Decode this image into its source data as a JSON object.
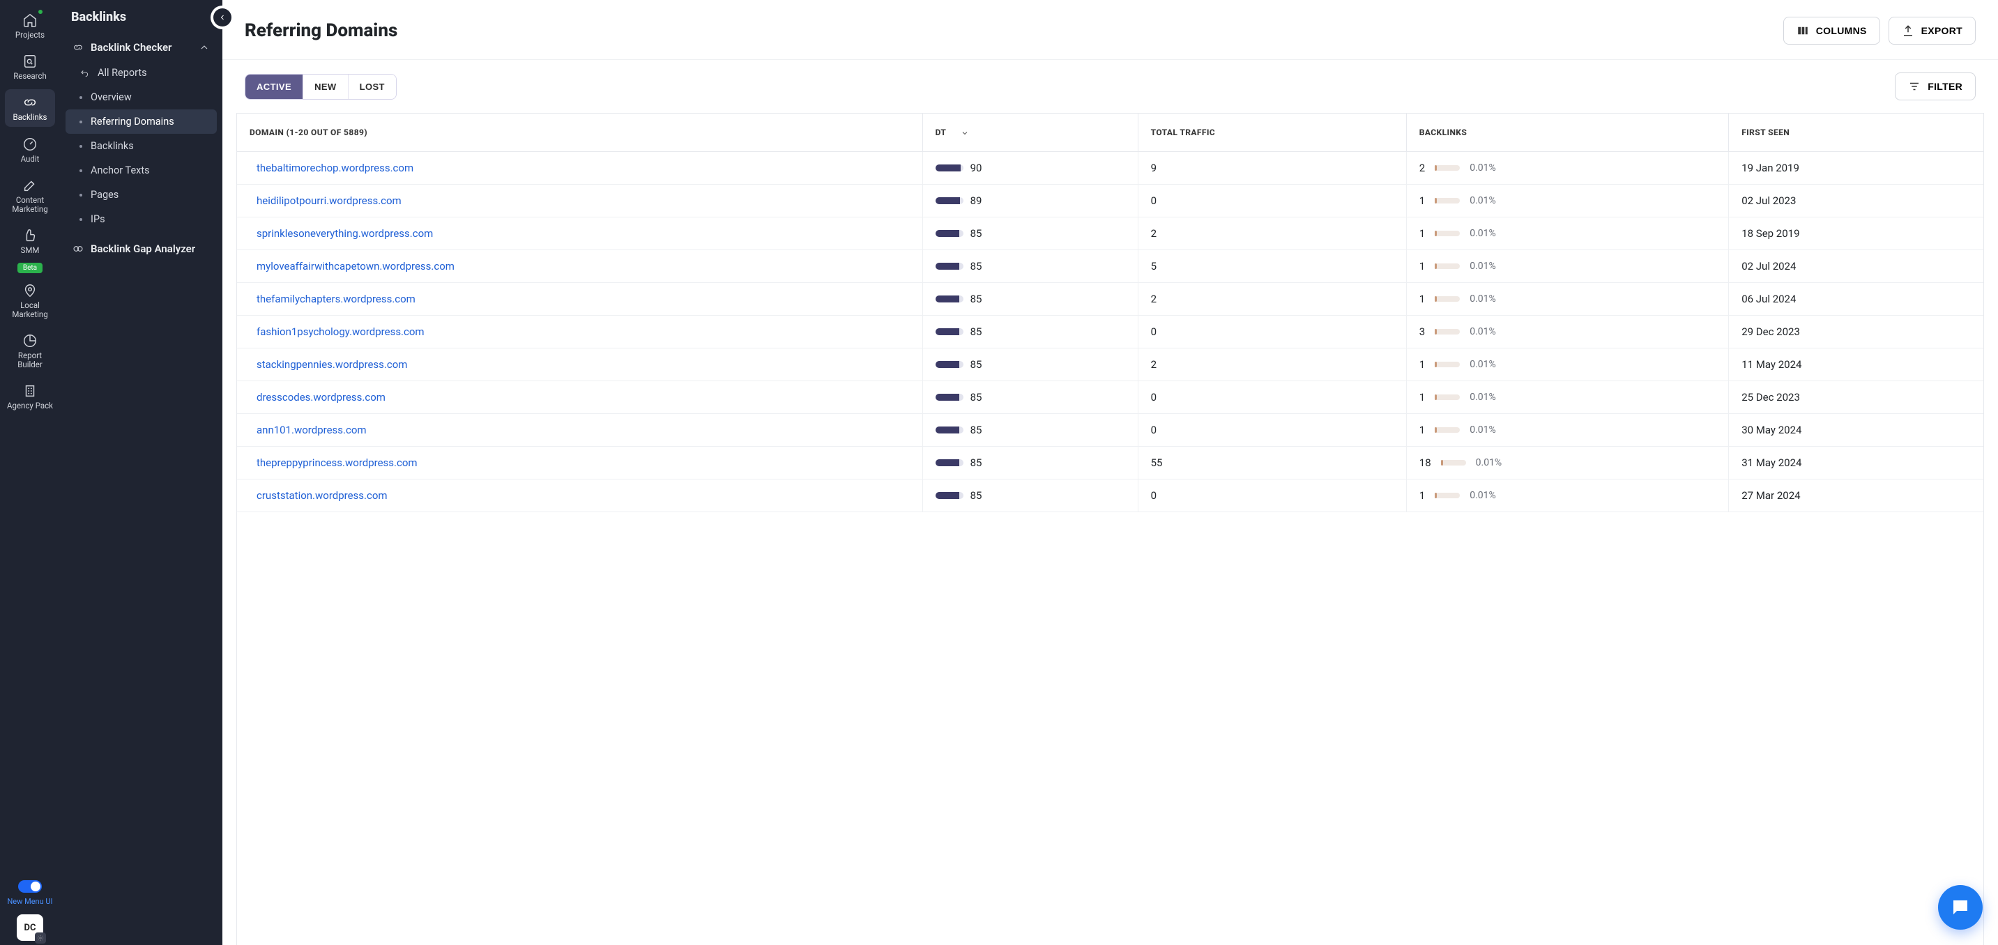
{
  "rail": {
    "items": [
      {
        "label": "Projects",
        "icon": "home"
      },
      {
        "label": "Research",
        "icon": "file-search"
      },
      {
        "label": "Backlinks",
        "icon": "link",
        "active": true
      },
      {
        "label": "Audit",
        "icon": "gauge"
      },
      {
        "label": "Content Marketing",
        "icon": "edit"
      },
      {
        "label": "SMM",
        "icon": "thumb",
        "badge": "Beta"
      },
      {
        "label": "Local Marketing",
        "icon": "pin"
      },
      {
        "label": "Report Builder",
        "icon": "pie"
      },
      {
        "label": "Agency Pack",
        "icon": "building"
      }
    ],
    "toggle_label": "New Menu UI",
    "avatar": "DC"
  },
  "sidebar": {
    "title": "Backlinks",
    "group_label": "Backlink Checker",
    "items": [
      {
        "label": "All Reports",
        "icon": "back"
      },
      {
        "label": "Overview"
      },
      {
        "label": "Referring Domains",
        "active": true
      },
      {
        "label": "Backlinks"
      },
      {
        "label": "Anchor Texts"
      },
      {
        "label": "Pages"
      },
      {
        "label": "IPs"
      }
    ],
    "group2_label": "Backlink Gap Analyzer"
  },
  "header": {
    "title": "Referring Domains",
    "columns_btn": "COLUMNS",
    "export_btn": "EXPORT"
  },
  "tabs": {
    "active": "ACTIVE",
    "new": "NEW",
    "lost": "LOST"
  },
  "filter_btn": "FILTER",
  "table": {
    "columns": {
      "domain": "DOMAIN (1-20 OUT OF 5889)",
      "dt": "DT",
      "traffic": "TOTAL TRAFFIC",
      "backlinks": "BACKLINKS",
      "first": "FIRST SEEN"
    },
    "rows": [
      {
        "domain": "thebaltimorechop.wordpress.com",
        "dt": 90,
        "traffic": "9",
        "bl": 2,
        "pct": "0.01%",
        "first": "19 Jan 2019"
      },
      {
        "domain": "heidilipotpourri.wordpress.com",
        "dt": 89,
        "traffic": "0",
        "bl": 1,
        "pct": "0.01%",
        "first": "02 Jul 2023"
      },
      {
        "domain": "sprinklesoneverything.wordpress.com",
        "dt": 85,
        "traffic": "2",
        "bl": 1,
        "pct": "0.01%",
        "first": "18 Sep 2019"
      },
      {
        "domain": "myloveaffairwithcapetown.wordpress.com",
        "dt": 85,
        "traffic": "5",
        "bl": 1,
        "pct": "0.01%",
        "first": "02 Jul 2024"
      },
      {
        "domain": "thefamilychapters.wordpress.com",
        "dt": 85,
        "traffic": "2",
        "bl": 1,
        "pct": "0.01%",
        "first": "06 Jul 2024"
      },
      {
        "domain": "fashion1psychology.wordpress.com",
        "dt": 85,
        "traffic": "0",
        "bl": 3,
        "pct": "0.01%",
        "first": "29 Dec 2023"
      },
      {
        "domain": "stackingpennies.wordpress.com",
        "dt": 85,
        "traffic": "2",
        "bl": 1,
        "pct": "0.01%",
        "first": "11 May 2024"
      },
      {
        "domain": "dresscodes.wordpress.com",
        "dt": 85,
        "traffic": "0",
        "bl": 1,
        "pct": "0.01%",
        "first": "25 Dec 2023"
      },
      {
        "domain": "ann101.wordpress.com",
        "dt": 85,
        "traffic": "0",
        "bl": 1,
        "pct": "0.01%",
        "first": "30 May 2024"
      },
      {
        "domain": "thepreppyprincess.wordpress.com",
        "dt": 85,
        "traffic": "55",
        "bl": 18,
        "pct": "0.01%",
        "first": "31 May 2024"
      },
      {
        "domain": "cruststation.wordpress.com",
        "dt": 85,
        "traffic": "0",
        "bl": 1,
        "pct": "0.01%",
        "first": "27 Mar 2024"
      }
    ]
  }
}
